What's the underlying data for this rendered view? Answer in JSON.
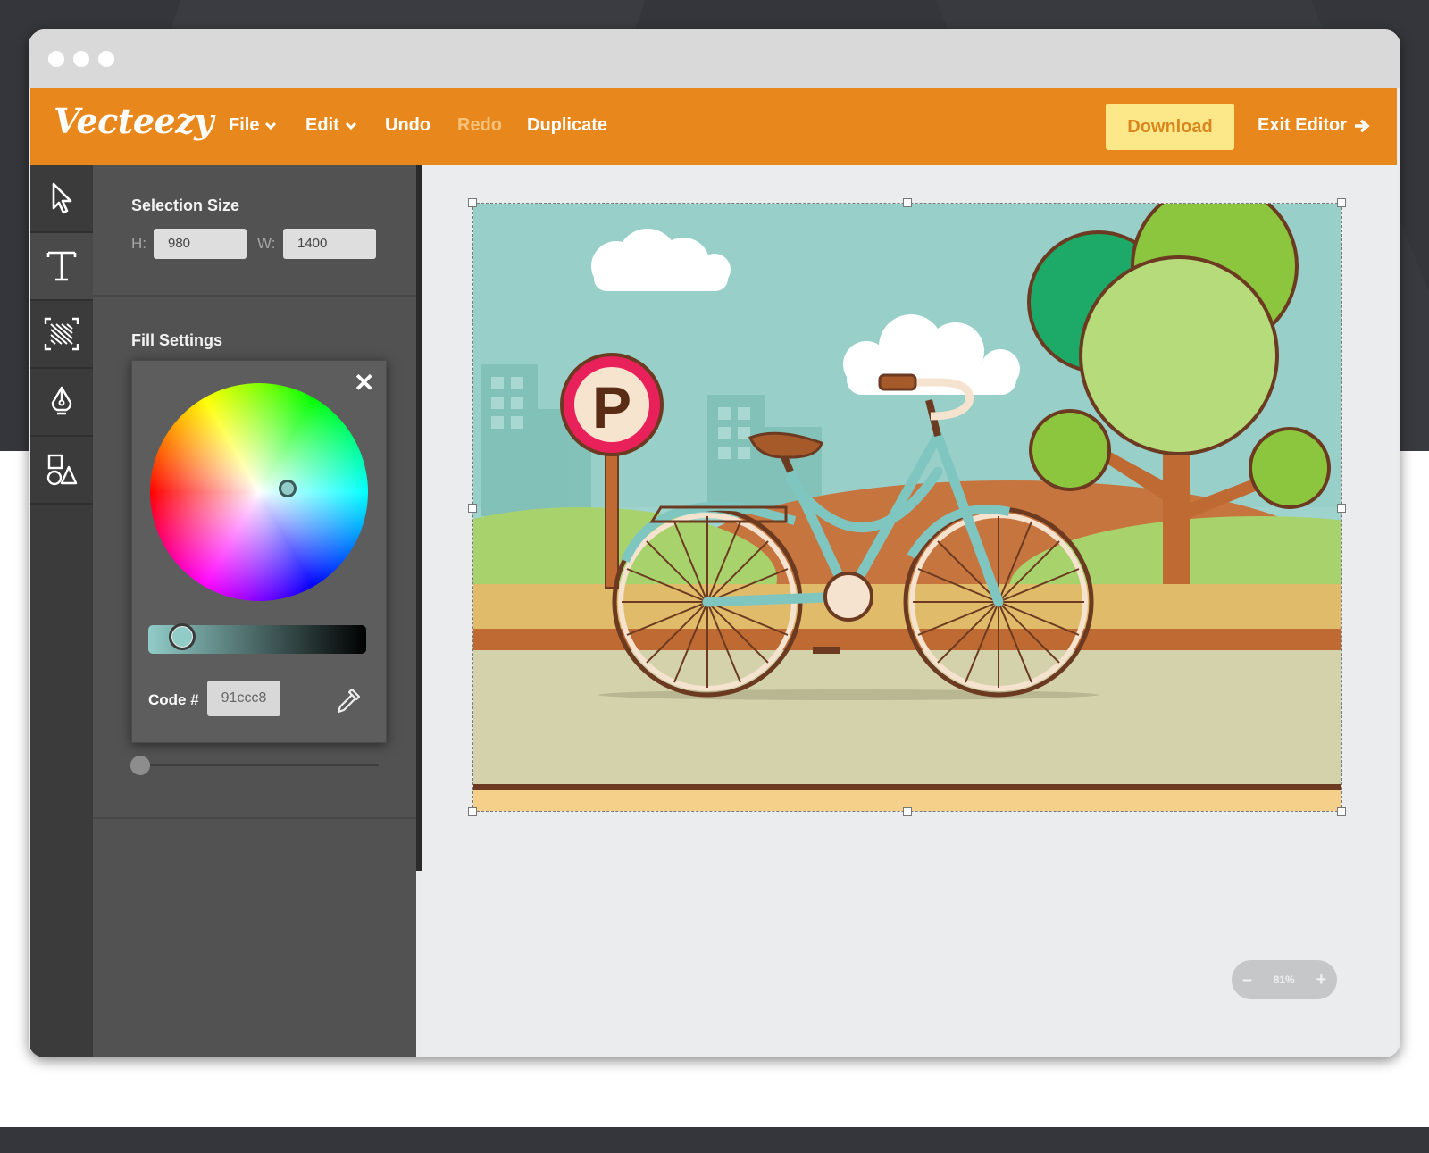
{
  "app": {
    "logo": "Vecteezy",
    "menu": {
      "file": "File",
      "edit": "Edit",
      "undo": "Undo",
      "redo": "Redo",
      "duplicate": "Duplicate"
    },
    "download_label": "Download",
    "exit_label": "Exit Editor",
    "brand_color": "#e8871b"
  },
  "tools": [
    "select-tool-icon",
    "text-tool-icon",
    "pattern-tool-icon",
    "pen-tool-icon",
    "shapes-tool-icon"
  ],
  "panel": {
    "selection_size_title": "Selection Size",
    "height_label": "H:",
    "height_value": "980",
    "width_label": "W:",
    "width_value": "1400",
    "fill_settings_title": "Fill Settings",
    "picker": {
      "close_symbol": "✕",
      "code_label": "Code #",
      "code_value": "91ccc8",
      "selected_color": "#91ccc8"
    }
  },
  "canvas": {
    "zoom_minus": "–",
    "zoom_level": "81%",
    "zoom_plus": "+"
  }
}
